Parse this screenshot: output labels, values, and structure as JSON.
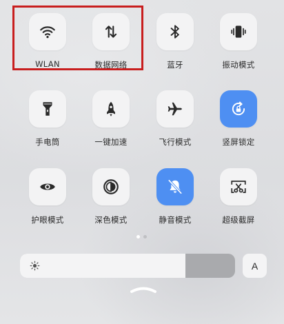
{
  "tiles": [
    {
      "label": "WLAN",
      "icon": "wifi-icon",
      "active": false
    },
    {
      "label": "数据网络",
      "icon": "data-transfer-icon",
      "active": false
    },
    {
      "label": "蓝牙",
      "icon": "bluetooth-icon",
      "active": false
    },
    {
      "label": "振动模式",
      "icon": "vibrate-icon",
      "active": false
    },
    {
      "label": "手电筒",
      "icon": "flashlight-icon",
      "active": false
    },
    {
      "label": "一键加速",
      "icon": "rocket-icon",
      "active": false
    },
    {
      "label": "飞行模式",
      "icon": "airplane-icon",
      "active": false
    },
    {
      "label": "竖屏锁定",
      "icon": "rotation-lock-icon",
      "active": true
    },
    {
      "label": "护眼模式",
      "icon": "eye-icon",
      "active": false
    },
    {
      "label": "深色模式",
      "icon": "dark-mode-icon",
      "active": false
    },
    {
      "label": "静音模式",
      "icon": "bell-mute-icon",
      "active": true
    },
    {
      "label": "超级截屏",
      "icon": "screenshot-icon",
      "active": false
    }
  ],
  "pager": {
    "pages": 2,
    "current": 1
  },
  "brightness": {
    "level": 0.77,
    "icon": "sun-icon"
  },
  "auto_brightness": {
    "label": "A"
  },
  "colors": {
    "active": "#4e8ff2",
    "tile": "#f3f3f4",
    "highlight": "#c81e1e"
  }
}
